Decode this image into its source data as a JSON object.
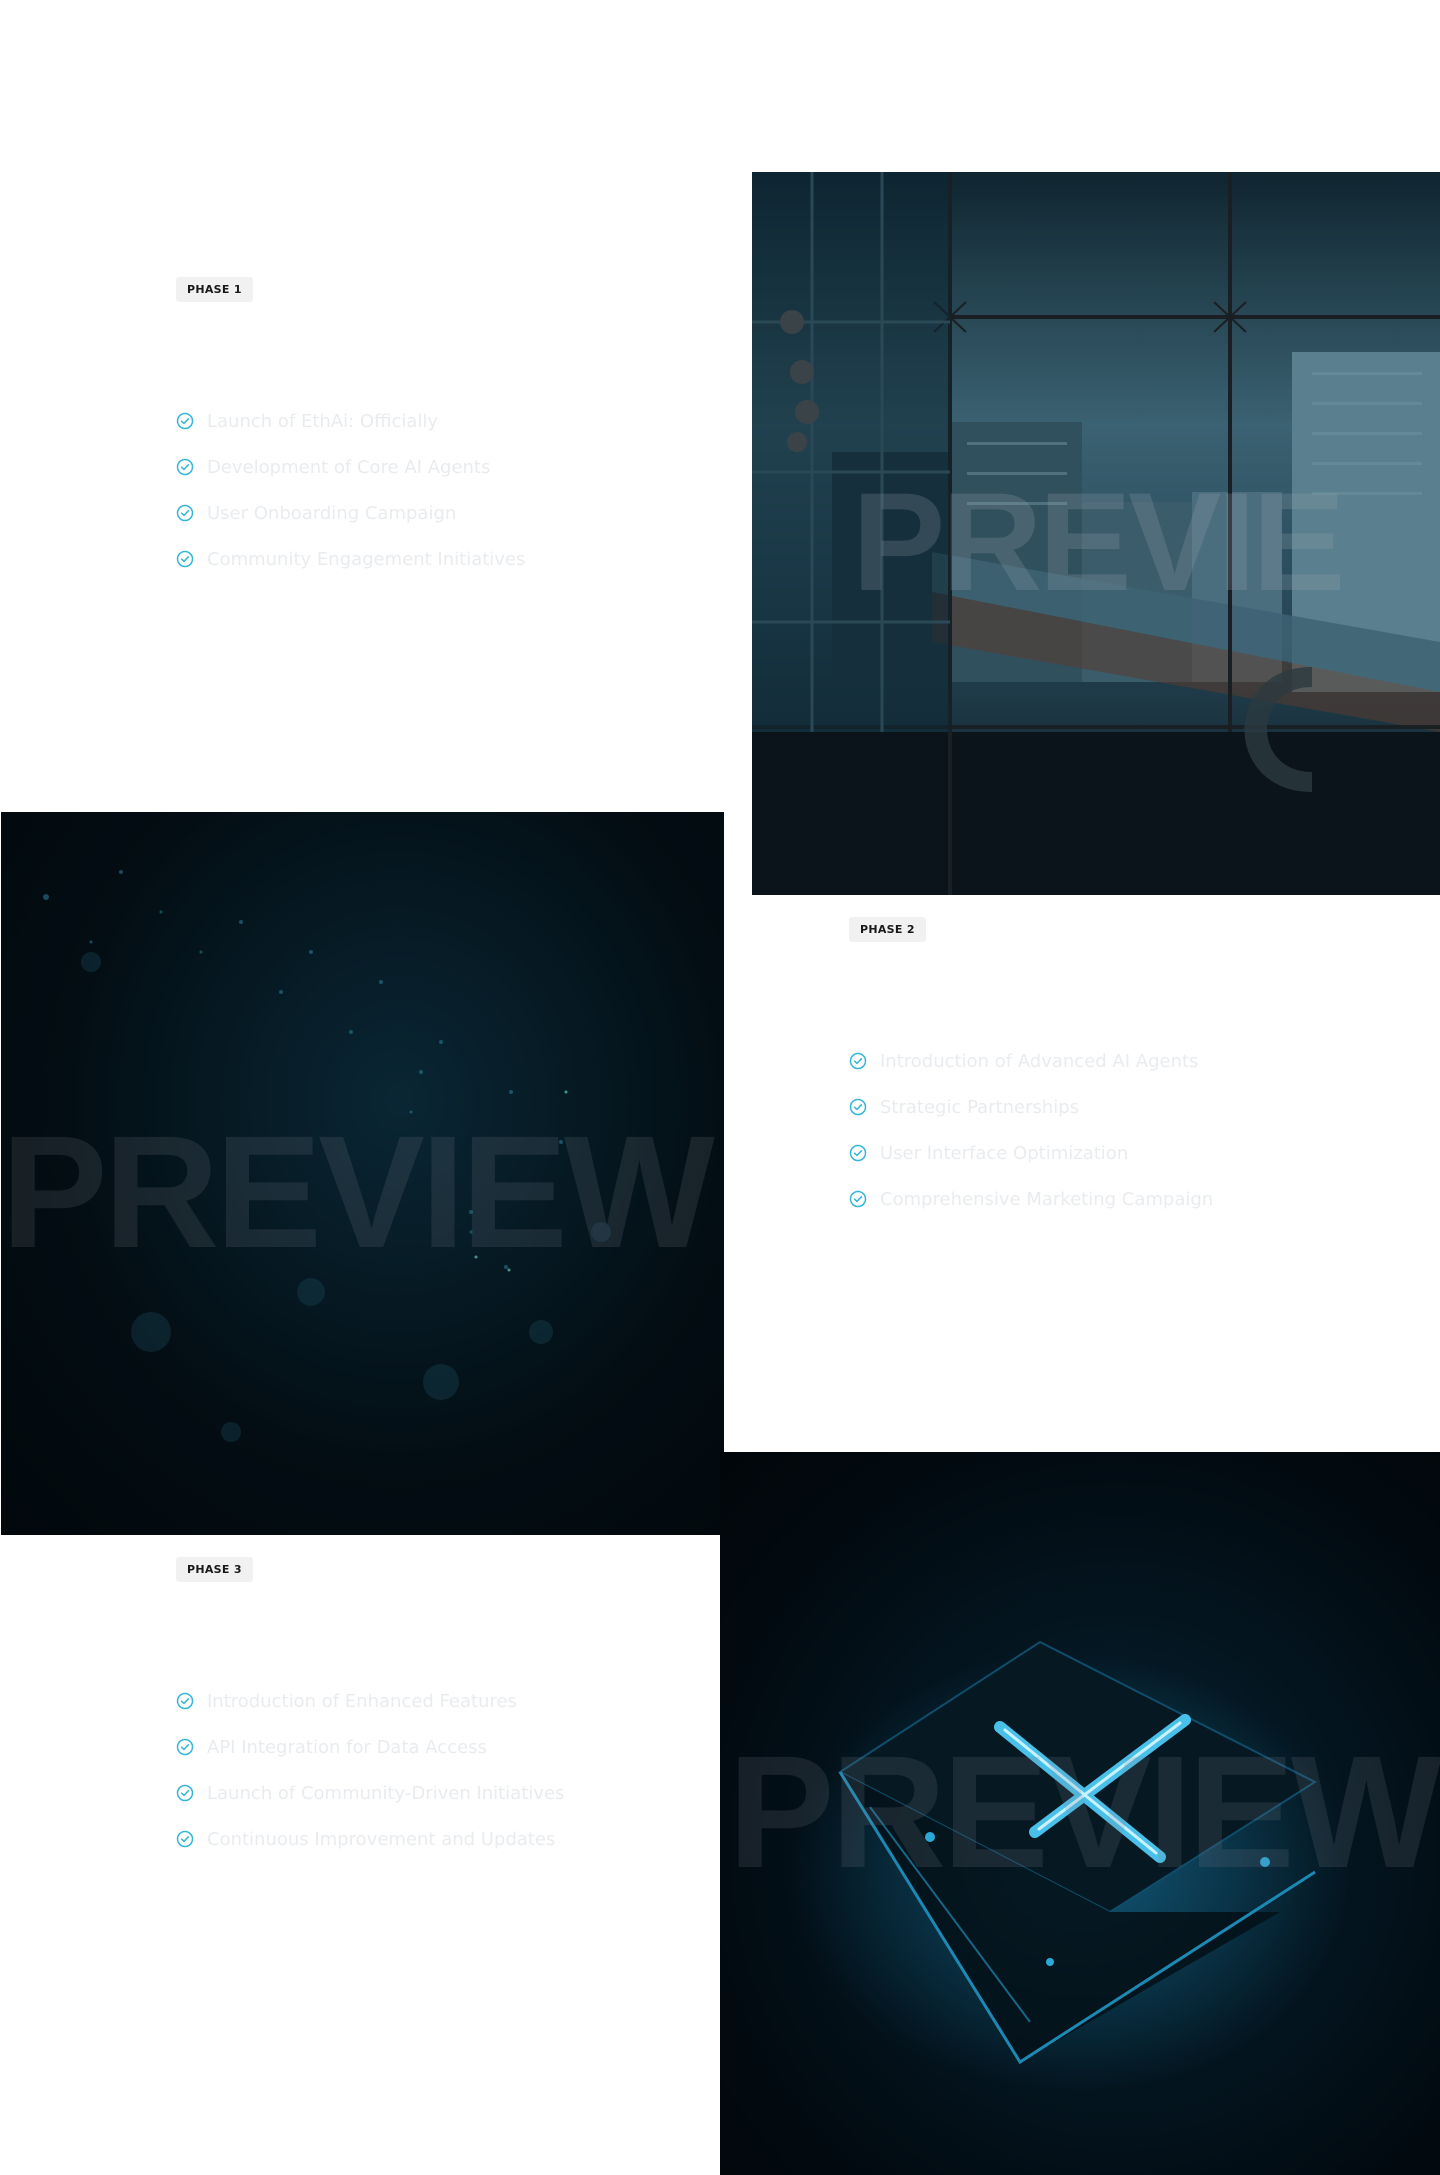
{
  "phases": [
    {
      "badge": "PHASE 1",
      "items": [
        "Launch of EthAi: Officially",
        "Development of Core AI Agents",
        "User Onboarding Campaign",
        "Community Engagement Initiatives"
      ]
    },
    {
      "badge": "PHASE 2",
      "items": [
        "Introduction of Advanced AI Agents",
        "Strategic Partnerships",
        "User Interface Optimization",
        "Comprehensive Marketing Campaign"
      ]
    },
    {
      "badge": "PHASE 3",
      "items": [
        "Introduction of Enhanced Features",
        "API Integration for Data Access",
        "Launch of Community-Driven Initiatives",
        "Continuous Improvement and Updates"
      ]
    }
  ],
  "images": {
    "city_watermark": "PREVIE",
    "particles_watermark": "PREVIEW",
    "chip_watermark": "PREVIEW"
  },
  "colors": {
    "check_accent": "#35b6d8",
    "item_text": "#e9ecef",
    "badge_bg": "#f1f1f1",
    "badge_text": "#1a1a1a"
  },
  "icons": {
    "check": "check-circle-icon"
  }
}
